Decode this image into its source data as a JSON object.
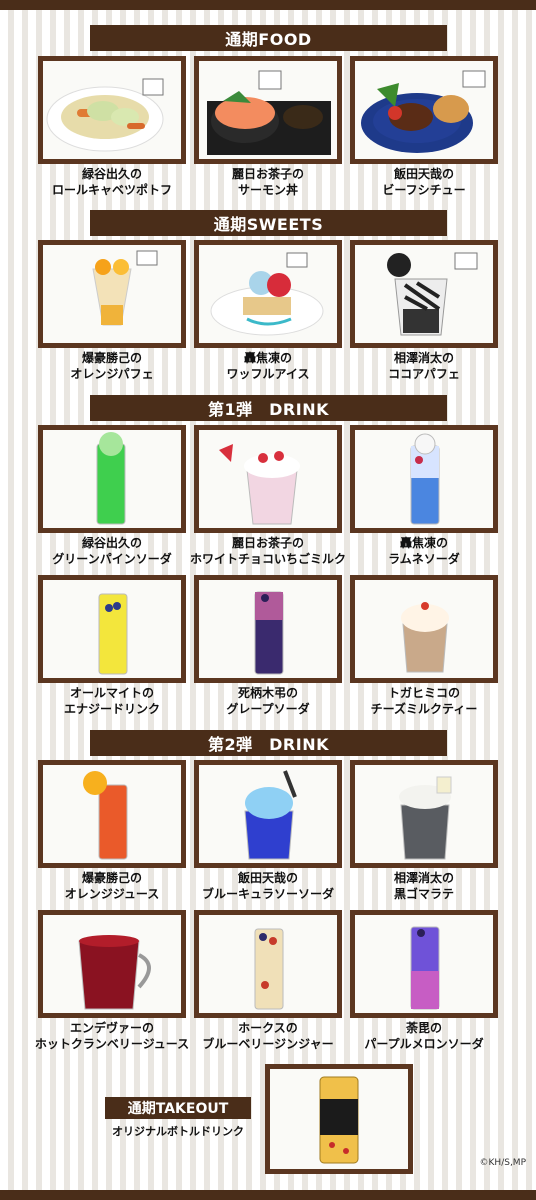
{
  "headers": {
    "food": "通期FOOD",
    "sweets": "通期SWEETS",
    "drink1": "第1弾　DRINK",
    "drink2": "第2弾　DRINK",
    "takeout": "通期TAKEOUT"
  },
  "items": {
    "food1": [
      "緑谷出久の",
      "ロールキャベツポトフ"
    ],
    "food2": [
      "麗日お茶子の",
      "サーモン丼"
    ],
    "food3": [
      "飯田天哉の",
      "ビーフシチュー"
    ],
    "sweet1": [
      "爆豪勝己の",
      "オレンジパフェ"
    ],
    "sweet2": [
      "轟焦凍の",
      "ワッフルアイス"
    ],
    "sweet3": [
      "相澤消太の",
      "ココアパフェ"
    ],
    "d1a": [
      "緑谷出久の",
      "グリーンパインソーダ"
    ],
    "d1b": [
      "麗日お茶子の",
      "ホワイトチョコいちごミルク"
    ],
    "d1c": [
      "轟焦凍の",
      "ラムネソーダ"
    ],
    "d1d": [
      "オールマイトの",
      "エナジードリンク"
    ],
    "d1e": [
      "死柄木弔の",
      "グレープソーダ"
    ],
    "d1f": [
      "トガヒミコの",
      "チーズミルクティー"
    ],
    "d2a": [
      "爆豪勝己の",
      "オレンジジュース"
    ],
    "d2b": [
      "飯田天哉の",
      "ブルーキュラソーソーダ"
    ],
    "d2c": [
      "相澤消太の",
      "黒ゴマラテ"
    ],
    "d2d": [
      "エンデヴァーの",
      "ホットクランベリージュース"
    ],
    "d2e": [
      "ホークスの",
      "ブルーベリージンジャー"
    ],
    "d2f": [
      "荼毘の",
      "パープルメロンソーダ"
    ]
  },
  "takeout_label": "オリジナルボトルドリンク",
  "copyright": "©KH/S,MP",
  "colors": {
    "brown": "#4a2d19",
    "frame": "#5b3620"
  }
}
